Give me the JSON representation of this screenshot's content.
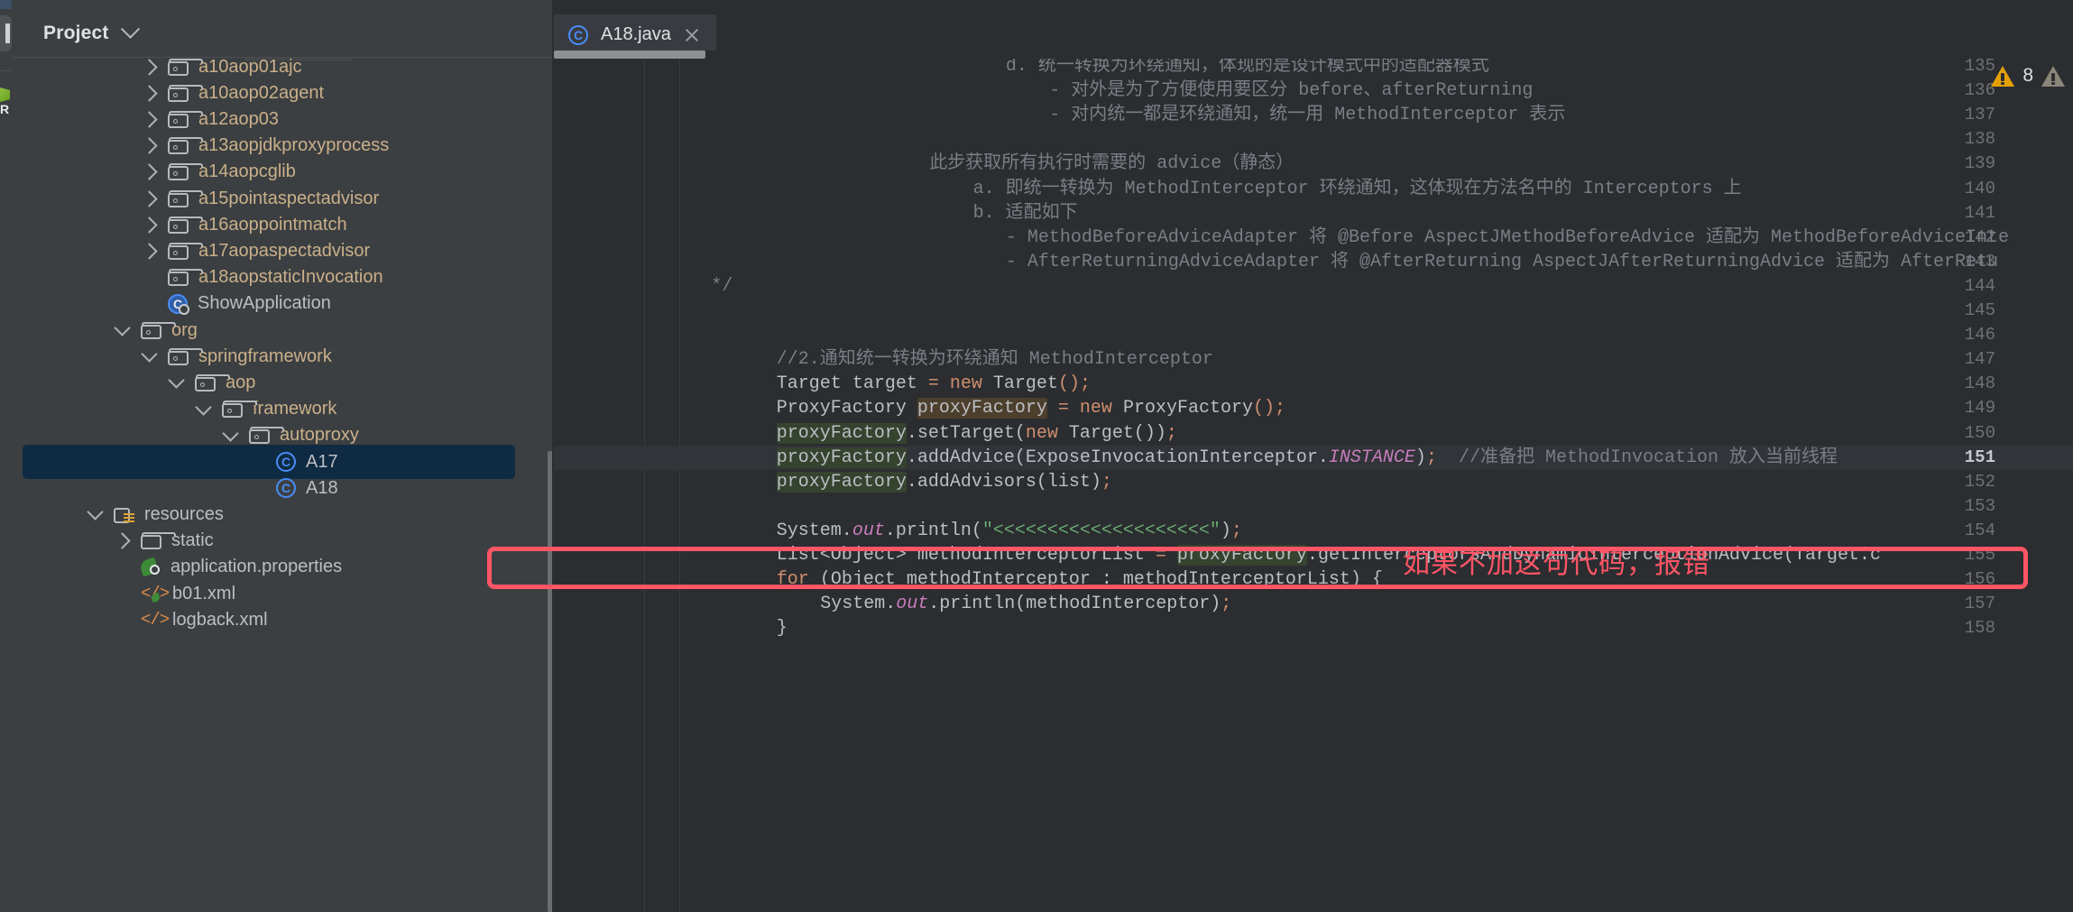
{
  "window": {
    "left_strip": {
      "tool_button": "tool-window-handle",
      "run_glyph": "run-config-glyph",
      "letter": "R"
    }
  },
  "project_panel": {
    "title": "Project",
    "dropdown_icon": "chevron-down-icon",
    "tree": [
      {
        "label": "a10aop01ajc",
        "indent": 3,
        "arrow": "right",
        "icon": "package-folder",
        "kind": "pkg"
      },
      {
        "label": "a10aop02agent",
        "indent": 3,
        "arrow": "right",
        "icon": "package-folder",
        "kind": "pkg"
      },
      {
        "label": "a12aop03",
        "indent": 3,
        "arrow": "right",
        "icon": "package-folder",
        "kind": "pkg"
      },
      {
        "label": "a13aopjdkproxyprocess",
        "indent": 3,
        "arrow": "right",
        "icon": "package-folder",
        "kind": "pkg"
      },
      {
        "label": "a14aopcglib",
        "indent": 3,
        "arrow": "right",
        "icon": "package-folder",
        "kind": "pkg"
      },
      {
        "label": "a15pointaspectadvisor",
        "indent": 3,
        "arrow": "right",
        "icon": "package-folder",
        "kind": "pkg"
      },
      {
        "label": "a16aoppointmatch",
        "indent": 3,
        "arrow": "right",
        "icon": "package-folder",
        "kind": "pkg"
      },
      {
        "label": "a17aopaspectadvisor",
        "indent": 3,
        "arrow": "right",
        "icon": "package-folder",
        "kind": "pkg"
      },
      {
        "label": "a18aopstaticInvocation",
        "indent": 3,
        "arrow": "none",
        "icon": "package-folder",
        "kind": "pkg"
      },
      {
        "label": "ShowApplication",
        "indent": 3,
        "arrow": "none",
        "icon": "spring-class",
        "kind": "file"
      },
      {
        "label": "org",
        "indent": 2,
        "arrow": "down",
        "icon": "package-folder",
        "kind": "pkg"
      },
      {
        "label": "springframework",
        "indent": 3,
        "arrow": "down",
        "icon": "package-folder",
        "kind": "pkg"
      },
      {
        "label": "aop",
        "indent": 4,
        "arrow": "down",
        "icon": "package-folder",
        "kind": "pkg"
      },
      {
        "label": "framework",
        "indent": 5,
        "arrow": "down",
        "icon": "package-folder",
        "kind": "pkg"
      },
      {
        "label": "autoproxy",
        "indent": 6,
        "arrow": "down",
        "icon": "package-folder",
        "kind": "pkg"
      },
      {
        "label": "A17",
        "indent": 7,
        "arrow": "none",
        "icon": "java-class",
        "kind": "file",
        "selected": true
      },
      {
        "label": "A18",
        "indent": 7,
        "arrow": "none",
        "icon": "java-class",
        "kind": "file"
      },
      {
        "label": "resources",
        "indent": 1,
        "arrow": "down",
        "icon": "resources-folder",
        "kind": "file"
      },
      {
        "label": "static",
        "indent": 2,
        "arrow": "right",
        "icon": "plain-folder",
        "kind": "file"
      },
      {
        "label": "application.properties",
        "indent": 2,
        "arrow": "none",
        "icon": "spring-file",
        "kind": "file"
      },
      {
        "label": "b01.xml",
        "indent": 2,
        "arrow": "none",
        "icon": "spring-xml",
        "kind": "file"
      },
      {
        "label": "logback.xml",
        "indent": 2,
        "arrow": "none",
        "icon": "xml",
        "kind": "file"
      }
    ],
    "scrollbar": "project-vertical-scrollbar"
  },
  "editor": {
    "tab": {
      "label": "A18.java",
      "icon": "java-class-icon",
      "close_icon": "close-icon"
    },
    "hscrollbar": "editor-horizontal-scrollbar",
    "current_line": 151,
    "first_line": 135,
    "lines": [
      {
        "n": 135,
        "indent": 29,
        "html": "<span class='cm'>d. 统一转换为环绕通知，体现的是设计模式中的适配器模式</span>"
      },
      {
        "n": 136,
        "indent": 33,
        "html": "<span class='cm'>- 对外是为了方便使用要区分 before、afterReturning</span>"
      },
      {
        "n": 137,
        "indent": 33,
        "html": "<span class='cm'>- 对内统一都是环绕通知，统一用 MethodInterceptor 表示</span>"
      },
      {
        "n": 138,
        "indent": 0,
        "html": ""
      },
      {
        "n": 139,
        "indent": 22,
        "html": "<span class='cm'>此步获取所有执行时需要的 advice（静态）</span>"
      },
      {
        "n": 140,
        "indent": 26,
        "html": "<span class='cm'>a. 即统一转换为 MethodInterceptor 环绕通知，这体现在方法名中的 Interceptors 上</span>"
      },
      {
        "n": 141,
        "indent": 26,
        "html": "<span class='cm'>b. 适配如下</span>"
      },
      {
        "n": 142,
        "indent": 29,
        "html": "<span class='cm'>- MethodBeforeAdviceAdapter 将 @Before AspectJMethodBeforeAdvice 适配为 MethodBeforeAdviceInte</span>"
      },
      {
        "n": 143,
        "indent": 29,
        "html": "<span class='cm'>- AfterReturningAdviceAdapter 将 @AfterReturning AspectJAfterReturningAdvice 适配为 AfterRetu</span>"
      },
      {
        "n": 144,
        "indent": 2,
        "html": "<span class='cm'>*/</span>"
      },
      {
        "n": 145,
        "indent": 0,
        "html": ""
      },
      {
        "n": 146,
        "indent": 0,
        "html": ""
      },
      {
        "n": 147,
        "indent": 8,
        "html": "<span class='cm'>//2.通知统一转换为环绕通知 MethodInterceptor</span>"
      },
      {
        "n": 148,
        "indent": 8,
        "html": "<span class='cls'>Target</span> <span class='ident'>target</span> <span class='semi'>=</span> <span class='kw'>new</span> <span class='cls'>Target</span><span class='semi'>();</span>"
      },
      {
        "n": 149,
        "indent": 8,
        "html": "<span class='cls'>ProxyFactory</span> <span class='hl-brown ident'>proxyFactory</span> <span class='semi'>=</span> <span class='kw'>new</span> <span class='cls'>ProxyFactory</span><span class='semi'>();</span>"
      },
      {
        "n": 150,
        "indent": 8,
        "html": "<span class='hl-green ident'>proxyFactory</span><span class='ident'>.setTarget(</span><span class='kw'>new</span><span class='ident'> Target())</span><span class='semi'>;</span>"
      },
      {
        "n": 151,
        "indent": 8,
        "html": "<span class='hl-green ident'>proxyFactory</span><span class='ident'>.addAdvice(ExposeInvocationInterceptor.</span><span class='purp'>INSTANCE</span><span class='ident'>)</span><span class='semi'>;</span>  <span class='cm'>//准备把 MethodInvocation 放入当前线程</span>"
      },
      {
        "n": 152,
        "indent": 8,
        "html": "<span class='hl-green ident'>proxyFactory</span><span class='ident'>.addAdvisors(list)</span><span class='semi'>;</span>"
      },
      {
        "n": 153,
        "indent": 0,
        "html": ""
      },
      {
        "n": 154,
        "indent": 8,
        "html": "<span class='ident'>System.</span><span class='stat'>out</span><span class='ident'>.println(</span><span class='str'>\"&lt;&lt;&lt;&lt;&lt;&lt;&lt;&lt;&lt;&lt;&lt;&lt;&lt;&lt;&lt;&lt;&lt;&lt;&lt;&lt;&quot;</span><span class='ident'>)</span><span class='semi'>;</span>"
      },
      {
        "n": 155,
        "indent": 8,
        "html": "<span class='cls'>List&lt;Object&gt;</span><span class='ident'> methodInterceptorList </span><span class='semi'>=</span><span class='ident'> </span><span class='hl-green ident'>proxyFactory</span><span class='ident'>.getInterceptorsAndDynamicInterceptionAdvice(Target.c</span>"
      },
      {
        "n": 156,
        "indent": 8,
        "html": "<span class='kw'>for</span><span class='ident'> (Object methodInterceptor : methodInterceptorList) {</span>"
      },
      {
        "n": 157,
        "indent": 12,
        "html": "<span class='ident'>System.</span><span class='stat'>out</span><span class='ident'>.println(methodInterceptor)</span><span class='semi'>;</span>"
      },
      {
        "n": 158,
        "indent": 8,
        "html": "<span class='ident'>}</span>"
      }
    ],
    "annotation": {
      "text": "如果不加这句代码，报错",
      "color": "#ff5566",
      "highlight_box_line": 151
    },
    "inspections": [
      {
        "icon": "warning-triangle-yellow",
        "count": "8",
        "color": "#e3a008"
      },
      {
        "icon": "warning-triangle-grey",
        "count": "",
        "color": "#8a8679"
      }
    ]
  }
}
